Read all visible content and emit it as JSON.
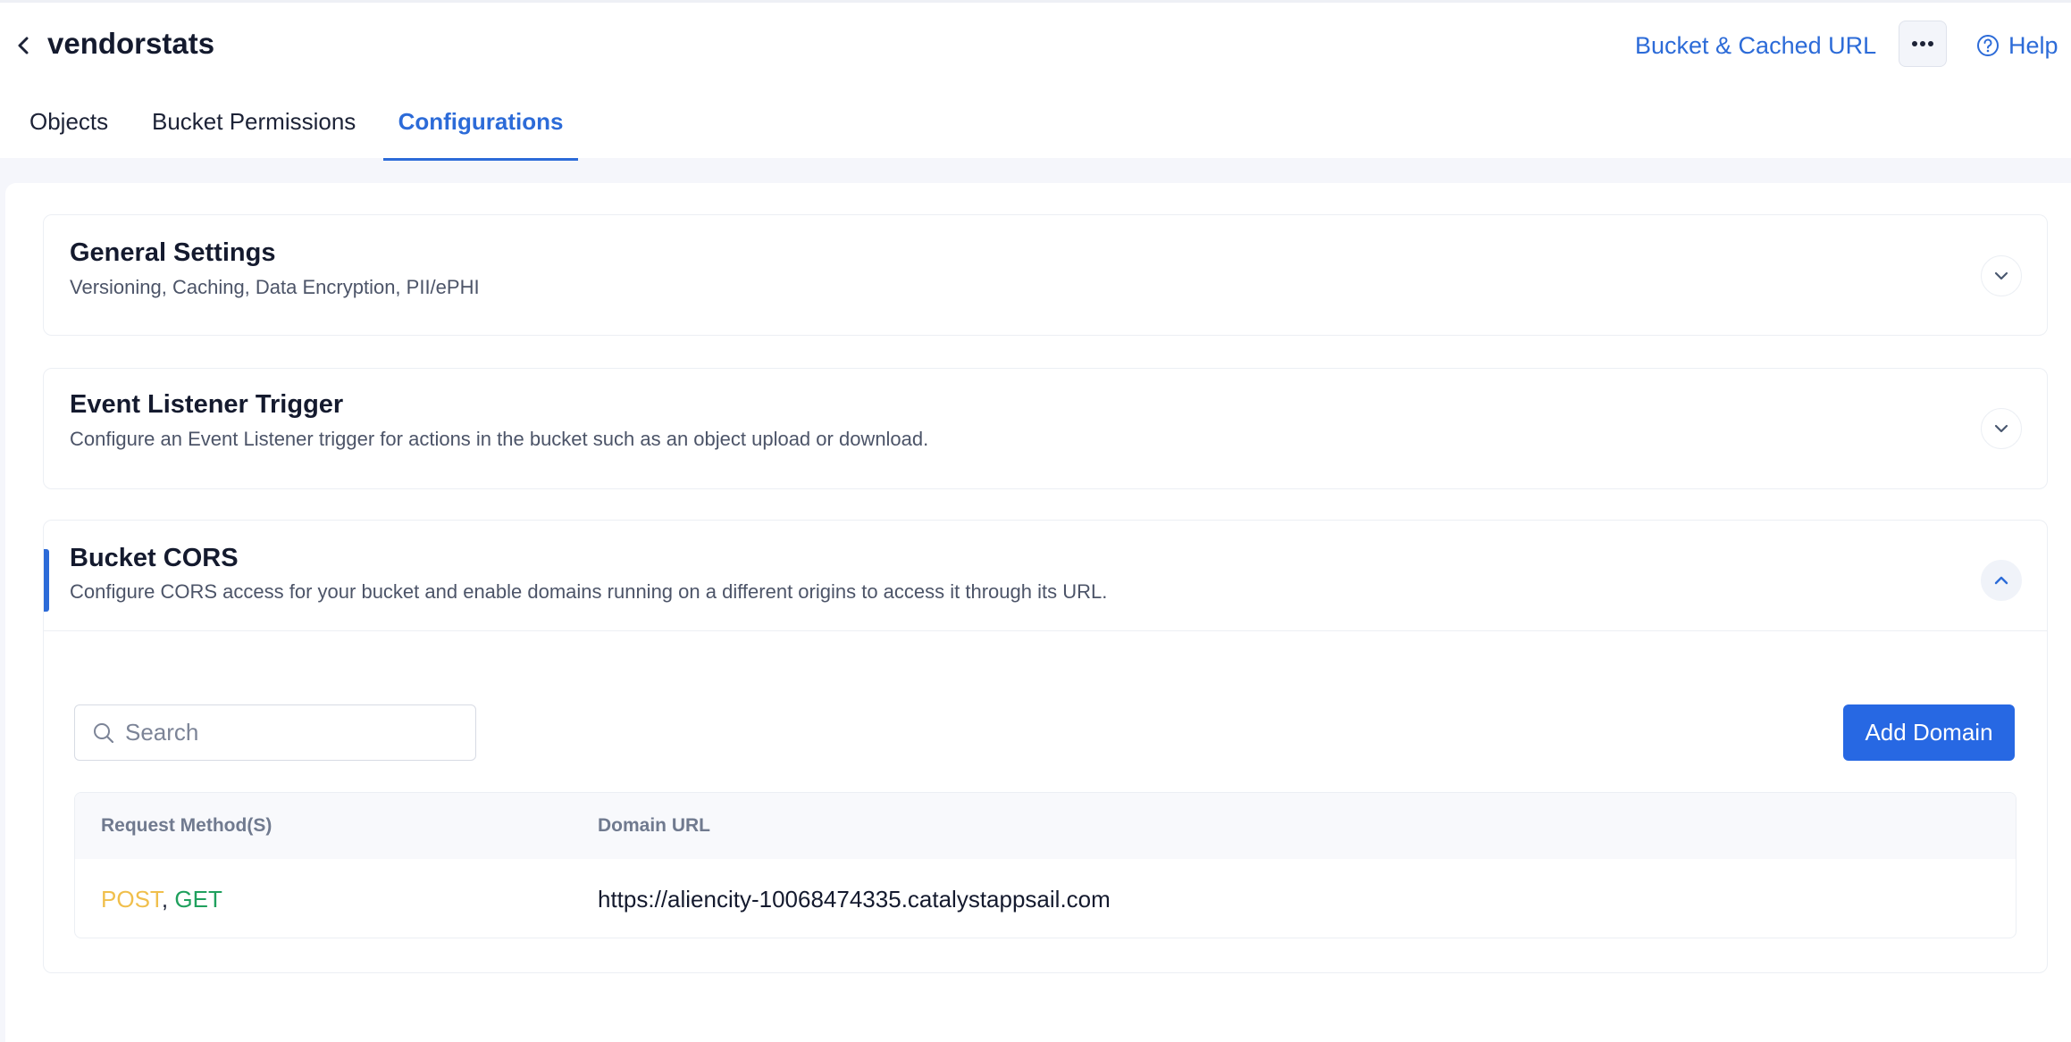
{
  "header": {
    "bucket_name": "vendorstats",
    "bucket_url_link": "Bucket & Cached URL",
    "help": "Help",
    "icons": {
      "back": "chevron-left-icon",
      "more": "more-horizontal-icon",
      "help": "help-circle-icon"
    }
  },
  "tabs": [
    {
      "label": "Objects",
      "active": false
    },
    {
      "label": "Bucket Permissions",
      "active": false
    },
    {
      "label": "Configurations",
      "active": true
    }
  ],
  "sections": {
    "general": {
      "title": "General Settings",
      "description": "Versioning, Caching, Data Encryption, PII/ePHI",
      "expanded": false
    },
    "event_listener": {
      "title": "Event Listener Trigger",
      "description": "Configure an Event Listener trigger for actions in the bucket such as an object upload or download.",
      "expanded": false
    },
    "cors": {
      "title": "Bucket CORS",
      "description": "Configure CORS access for your bucket and enable domains running on a different origins to access it through its URL.",
      "expanded": true,
      "search_placeholder": "Search",
      "add_button": "Add Domain",
      "table": {
        "columns": [
          "Request Method(S)",
          "Domain URL"
        ],
        "rows": [
          {
            "methods": [
              "POST",
              "GET"
            ],
            "separator": ",",
            "domain_url": "https://aliencity-10068474335.catalystappsail.com"
          }
        ]
      }
    }
  },
  "colors": {
    "accent": "#2c6bd8",
    "primary_button": "#2768e3",
    "method_post": "#f0bf4c",
    "method_get": "#1fa05d"
  }
}
